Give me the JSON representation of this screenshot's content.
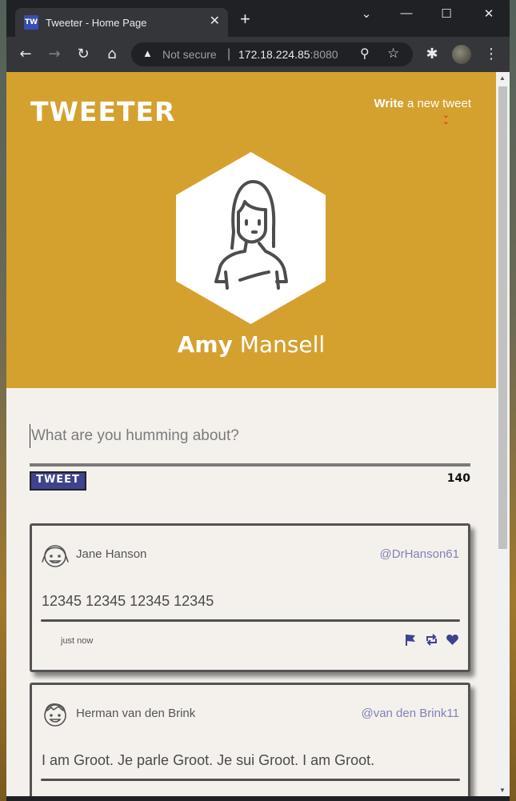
{
  "browser": {
    "tab_title": "Tweeter - Home Page",
    "tab_favicon": "TW",
    "new_tab_label": "+",
    "address": {
      "security_label": "Not secure",
      "host": "172.18.224.85",
      "port": ":8080"
    }
  },
  "header": {
    "brand": "TWEETER",
    "compose_bold": "Write",
    "compose_rest": " a new tweet",
    "compose_icon": "double-chevron-down-icon"
  },
  "profile": {
    "first_name": "Amy",
    "last_name": " Mansell",
    "avatar_icon": "girl-avatar-icon"
  },
  "composer": {
    "placeholder": "What are you humming about?",
    "button_label": "TWEET",
    "counter": "140"
  },
  "tweets": [
    {
      "author": "Jane Hanson",
      "handle": "@DrHanson61",
      "content": "12345 12345 12345 12345",
      "time": "just now",
      "avatar_icon": "girl-face-icon"
    },
    {
      "author": "Herman van den Brink",
      "handle": "@van den Brink11",
      "content": "I am Groot. Je parle Groot. Je sui Groot. I am Groot.",
      "time": "",
      "avatar_icon": "boy-face-icon"
    }
  ],
  "colors": {
    "header_bg": "#d4a12f",
    "accent": "#3f428d",
    "handle": "#8182b5",
    "page_bg": "#f4f1ed"
  }
}
